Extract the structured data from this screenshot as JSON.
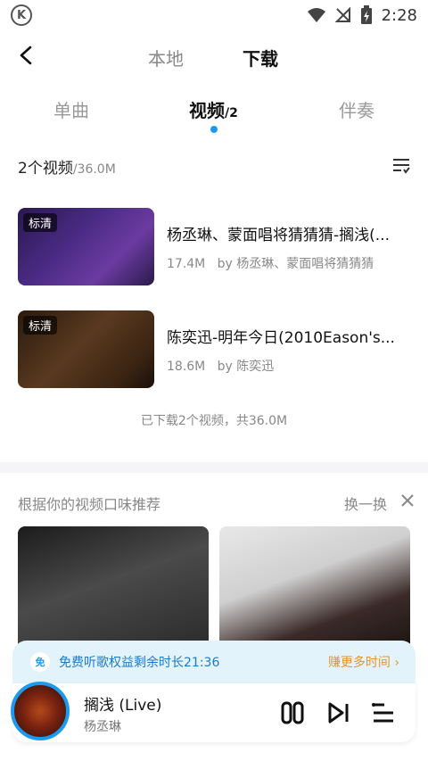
{
  "status_bar": {
    "time": "2:28",
    "icons": [
      "k-logo-icon",
      "wifi-icon",
      "no-signal-icon",
      "battery-charging-icon"
    ],
    "k_logo_letter": "K"
  },
  "nav": {
    "local_tab": "本地",
    "download_tab": "下载"
  },
  "sub_tabs": {
    "single": "单曲",
    "video": "视频",
    "video_count": "/2",
    "accompaniment": "伴奏"
  },
  "summary": {
    "count_label": "2个视频",
    "size": "/36.0M"
  },
  "videos": [
    {
      "badge": "标清",
      "title": "杨丞琳、蒙面唱将猜猜猜-搁浅(...",
      "size": "17.4M",
      "by": "by 杨丞琳、蒙面唱将猜猜猜"
    },
    {
      "badge": "标清",
      "title": "陈奕迅-明年今日(2010Eason's...",
      "size": "18.6M",
      "by": "by 陈奕迅"
    }
  ],
  "downloaded_total": "已下载2个视频，共36.0M",
  "recommend": {
    "title": "根据你的视频口味推荐",
    "refresh": "换一换"
  },
  "free_banner": {
    "tag": "免",
    "text": "免费听歌权益剩余时长21:36",
    "earn": "赚更多时间"
  },
  "player": {
    "song": "搁浅 (Live)",
    "artist": "杨丞琳"
  },
  "colors": {
    "accent": "#1a9bf0",
    "earn": "#e0962b"
  }
}
